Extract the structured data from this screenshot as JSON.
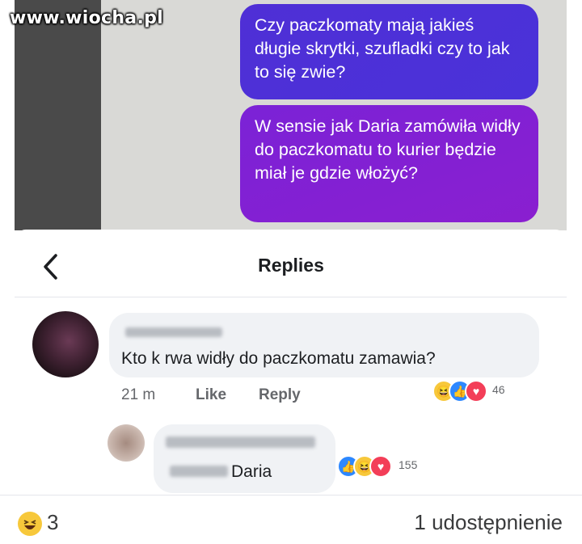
{
  "watermark": "www.wiocha.pl",
  "messages": [
    {
      "text": "Czy paczkomaty mają jakieś długie skrytki, szufladki czy to jak to się zwie?"
    },
    {
      "text": "W sensie jak Daria zamówiła widły do paczkomatu to kurier będzie miał je gdzie włożyć?"
    }
  ],
  "sheet": {
    "title": "Replies",
    "back_icon": "chevron-left-icon"
  },
  "comment": {
    "text": "Kto k  rwa widły do paczkomatu zamawia?",
    "time": "21 m",
    "like_label": "Like",
    "reply_label": "Reply",
    "reaction_count": "46",
    "reactions": [
      "haha",
      "like",
      "love"
    ]
  },
  "reply": {
    "mention": "Daria",
    "reaction_count": "155",
    "reactions": [
      "like",
      "haha",
      "love"
    ]
  },
  "footer": {
    "reaction_count": "3",
    "shares": "1 udostępnienie"
  },
  "colors": {
    "bubble_blue": "#4a32d9",
    "bubble_purple": "#8a1fd0",
    "fb_blue": "#2d88ff",
    "love_red": "#f33e58",
    "haha_yellow": "#f7c83b"
  }
}
